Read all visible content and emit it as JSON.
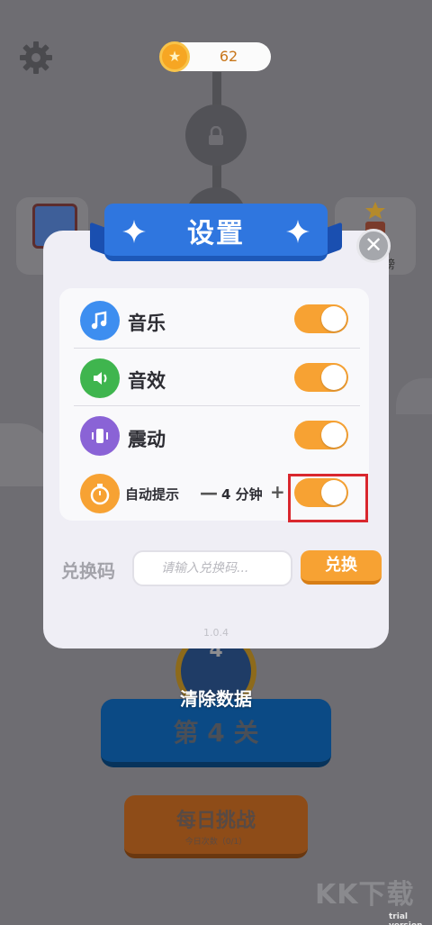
{
  "hud": {
    "coins": "62"
  },
  "background": {
    "level_number": "4",
    "clear_data_label": "清除数据",
    "level_button": "第 4 关",
    "daily_title": "每日挑战",
    "daily_sub": "今日次数（0/1）",
    "right_card_text": "榜",
    "watermark": "KK下载",
    "trial_text": "trial version"
  },
  "settings": {
    "title": "设置",
    "close": "✕",
    "rows": [
      {
        "label": "音乐",
        "icon": "music-note-icon",
        "color": "#3d8ef0",
        "on": true
      },
      {
        "label": "音效",
        "icon": "speaker-icon",
        "color": "#3fb54e",
        "on": true
      },
      {
        "label": "震动",
        "icon": "vibrate-icon",
        "color": "#8a63d6",
        "on": true
      }
    ],
    "hint": {
      "label": "自动提示",
      "minus": "—",
      "value": "4 分钟",
      "plus": "+",
      "on": true,
      "icon": "stopwatch-icon",
      "color": "#f7a233"
    },
    "redeem": {
      "label": "兑换码",
      "placeholder": "请输入兑换码...",
      "button": "兑换"
    },
    "version": "1.0.4"
  },
  "colors": {
    "toggle_on": "#f7a233",
    "ribbon": "#2f76df",
    "highlight": "#d9272e"
  }
}
